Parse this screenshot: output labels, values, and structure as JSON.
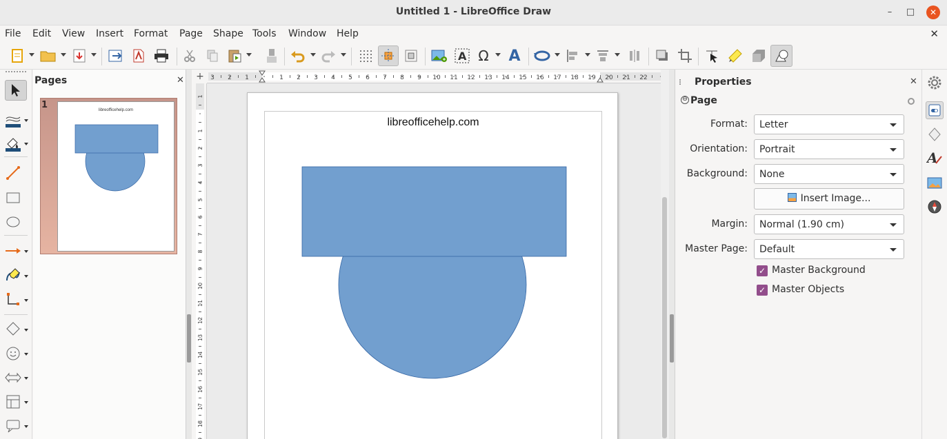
{
  "window": {
    "title": "Untitled 1 - LibreOffice Draw",
    "minimize": "–",
    "maximize": "□",
    "close": "✕"
  },
  "menubar": {
    "items": [
      "File",
      "Edit",
      "View",
      "Insert",
      "Format",
      "Page",
      "Shape",
      "Tools",
      "Window",
      "Help"
    ],
    "doc_close": "✕"
  },
  "toolbar": {
    "icons": [
      "new-document",
      "open",
      "export-pdf",
      "export",
      "export-directly-pdf",
      "print",
      "cut",
      "copy",
      "paste",
      "clone-formatting",
      "undo",
      "redo",
      "display-grid",
      "helplines-while-moving",
      "snap-to-grid",
      "insert-image",
      "insert-text-box",
      "special-character",
      "fontwork",
      "rotate",
      "align-objects",
      "arrange",
      "distribute",
      "shadow",
      "crop",
      "points",
      "glue-points",
      "toggle-extrusion",
      "shapes"
    ],
    "active_icons": [
      "helplines-while-moving",
      "shapes"
    ]
  },
  "left_toolbar": {
    "icons": [
      "select",
      "line-color",
      "fill-color",
      "line",
      "rectangle",
      "ellipse",
      "lines-and-arrows",
      "curves-and-polygons",
      "connectors",
      "basic-shapes",
      "symbol-shapes",
      "block-arrows",
      "flowchart",
      "callouts"
    ]
  },
  "pages_pane": {
    "title": "Pages",
    "close": "✕",
    "thumbnails": [
      {
        "number": "1",
        "text": "libreofficehelp.com",
        "selected": true
      }
    ]
  },
  "ruler": {
    "horizontal_ticks": [
      "3",
      "2",
      "1",
      "1",
      "2",
      "3",
      "4",
      "5",
      "6",
      "7",
      "8",
      "9",
      "10",
      "11",
      "12",
      "13",
      "14",
      "15",
      "16",
      "17",
      "18",
      "19",
      "20",
      "21",
      "22"
    ],
    "vertical_ticks": [
      "1",
      "1",
      "2",
      "3",
      "4",
      "5",
      "6",
      "7",
      "8",
      "9",
      "10",
      "11",
      "12",
      "13",
      "14",
      "15",
      "16",
      "17",
      "18",
      "19"
    ]
  },
  "canvas": {
    "page_text": "libreofficehelp.com",
    "shape_fill": "#729fcf",
    "shape_stroke": "#3465a4",
    "shapes": [
      "rectangle",
      "circle"
    ]
  },
  "properties": {
    "title": "Properties",
    "close": "✕",
    "section": "Page",
    "section_toggle": "⊖",
    "fields": {
      "format": {
        "label": "Format:",
        "value": "Letter"
      },
      "orientation": {
        "label": "Orientation:",
        "value": "Portrait"
      },
      "background": {
        "label": "Background:",
        "value": "None"
      },
      "insert_image": {
        "label": "Insert Image..."
      },
      "margin": {
        "label": "Margin:",
        "value": "Normal (1.90 cm)"
      },
      "master_page": {
        "label": "Master Page:",
        "value": "Default"
      }
    },
    "checkboxes": [
      {
        "label": "Master Background",
        "checked": true
      },
      {
        "label": "Master Objects",
        "checked": true
      }
    ],
    "check_color": "#924d8b"
  },
  "sidebar_tabs": [
    "sidebar-settings",
    "properties",
    "styles",
    "character",
    "gallery",
    "navigator"
  ]
}
